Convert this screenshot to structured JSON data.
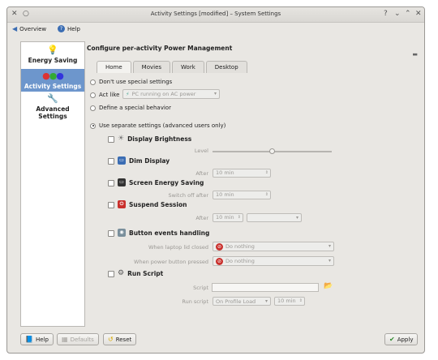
{
  "window": {
    "title": "Activity Settings [modified] – System Settings"
  },
  "nav": {
    "overview": "Overview",
    "help": "Help"
  },
  "sidebar": {
    "items": [
      {
        "label": "Energy Saving",
        "icon": "lightbulb-icon"
      },
      {
        "label": "Activity Settings",
        "icon": "activity-icon"
      },
      {
        "label": "Advanced Settings",
        "icon": "tools-icon"
      }
    ]
  },
  "main": {
    "heading": "Configure per-activity Power Management",
    "tabs": [
      "Home",
      "Movies",
      "Work",
      "Desktop"
    ],
    "radios": {
      "dont_use": "Don't use special settings",
      "act_like": "Act like",
      "act_like_value": "PC running on AC power",
      "define_special": "Define a special behavior",
      "use_separate": "Use separate settings (advanced users only)"
    },
    "sections": {
      "display_brightness": {
        "title": "Display Brightness",
        "level_label": "Level"
      },
      "dim_display": {
        "title": "Dim Display",
        "after_label": "After",
        "after_value": "10 min"
      },
      "screen_energy": {
        "title": "Screen Energy Saving",
        "switch_label": "Switch off after",
        "switch_value": "10 min"
      },
      "suspend": {
        "title": "Suspend Session",
        "after_label": "After",
        "after_value": "10 min"
      },
      "button_events": {
        "title": "Button events handling",
        "lid_label": "When laptop lid closed",
        "lid_value": "Do nothing",
        "power_label": "When power button pressed",
        "power_value": "Do nothing"
      },
      "run_script": {
        "title": "Run Script",
        "script_label": "Script",
        "runscript_label": "Run script",
        "runscript_value": "On Profile Load",
        "runscript_time": "10 min"
      }
    }
  },
  "footer": {
    "help": "Help",
    "defaults": "Defaults",
    "reset": "Reset",
    "apply": "Apply"
  },
  "colors": {
    "accent": "#6d96cc",
    "window_bg": "#e9e7e3"
  }
}
